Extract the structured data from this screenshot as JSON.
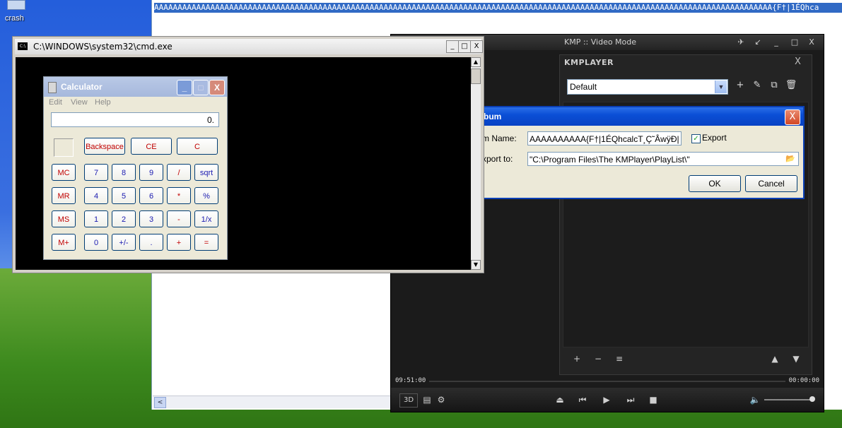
{
  "desktop": {
    "icon_label": "crash"
  },
  "notepad": {
    "selected_text": "AAAAAAAAAAAAAAAAAAAAAAAAAAAAAAAAAAAAAAAAAAAAAAAAAAAAAAAAAAAAAAAAAAAAAAAAAAAAAAAAAAAAAAAAAAAAAAAAAAAAAAAAAAAAAAAAAAAAAAAAAAAAAAAAAAAA{F†|1ÉQhca",
    "scroll_left": "<"
  },
  "cmd": {
    "title": "C:\\WINDOWS\\system32\\cmd.exe",
    "icon": "C:\\",
    "minimize": "_",
    "maximize": "□",
    "close": "X",
    "scroll_up": "▲",
    "scroll_down": "▼"
  },
  "calculator": {
    "title": "Calculator",
    "minimize": "_",
    "maximize": "□",
    "close": "X",
    "menu": [
      "Edit",
      "View",
      "Help"
    ],
    "display": "0.",
    "keys": {
      "backspace": "Backspace",
      "ce": "CE",
      "c": "C",
      "mc": "MC",
      "mr": "MR",
      "ms": "MS",
      "mplus": "M+",
      "k7": "7",
      "k8": "8",
      "k9": "9",
      "div": "/",
      "sqrt": "sqrt",
      "k4": "4",
      "k5": "5",
      "k6": "6",
      "mul": "*",
      "pct": "%",
      "k1": "1",
      "k2": "2",
      "k3": "3",
      "sub": "-",
      "inv": "1/x",
      "k0": "0",
      "neg": "+/-",
      "dot": ".",
      "add": "+",
      "eq": "="
    }
  },
  "kmp": {
    "title": "KMP :: Video Mode",
    "brand": "KMPLAYER",
    "playlist_select": "Default",
    "time_elapsed": "09:51:00",
    "time_total": "00:00:00",
    "btn_3d": "3D",
    "title_buttons": [
      "✈",
      "↙",
      "_",
      "□",
      "X"
    ],
    "panel_close": "X",
    "list_icons": [
      "+",
      "✎",
      "⧉",
      "🗑"
    ],
    "list_controls": [
      "+",
      "−",
      "≡",
      "▲",
      "▼"
    ],
    "transport": [
      "⏏",
      "⏮",
      "▶",
      "⏭",
      "■"
    ],
    "settings_icon": "⚙",
    "playlist_icon": "▤",
    "volume_icon": "🔈",
    "volume_level": 0.9
  },
  "album_dialog": {
    "title": "bum",
    "name_label": "m Name:",
    "name_value": "AAAAAAAAAA{F†|1ÉQhcalcT¸Ç˜ÂwÿÐ|",
    "export_label": "Export",
    "export_checked": true,
    "export_to_label": "xport to:",
    "export_path": "\"C:\\Program Files\\The KMPlayer\\PlayList\\\"",
    "ok": "OK",
    "cancel": "Cancel",
    "close": "X"
  }
}
